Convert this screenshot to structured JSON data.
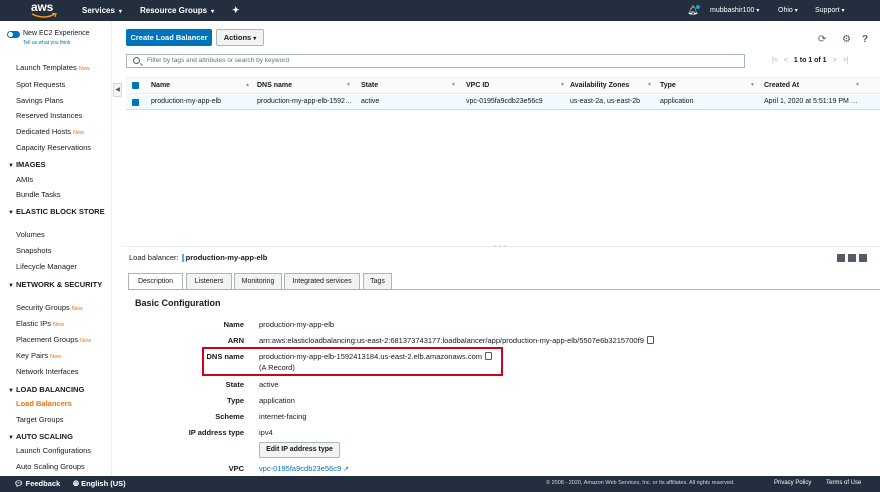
{
  "topnav": {
    "logo": "aws",
    "services": "Services",
    "resource_groups": "Resource Groups",
    "user": "mubbashir100",
    "region": "Ohio",
    "support": "Support"
  },
  "sidebar": {
    "experience_title": "New EC2 Experience",
    "experience_sub": "Tell us what you think",
    "new_tag": "New",
    "items": [
      {
        "label": "Launch Templates",
        "new": true
      },
      {
        "label": "Spot Requests",
        "new": false
      },
      {
        "label": "Savings Plans",
        "new": false
      },
      {
        "label": "Reserved Instances",
        "new": false
      },
      {
        "label": "Dedicated Hosts",
        "new": true
      },
      {
        "label": "Capacity Reservations",
        "new": false
      }
    ],
    "images_head": "IMAGES",
    "images_items": [
      "AMIs",
      "Bundle Tasks"
    ],
    "ebs_head": "ELASTIC BLOCK STORE",
    "ebs_items": [
      "Volumes",
      "Snapshots",
      "Lifecycle Manager"
    ],
    "net_head": "NETWORK & SECURITY",
    "net_items": [
      {
        "label": "Security Groups",
        "new": true
      },
      {
        "label": "Elastic IPs",
        "new": true
      },
      {
        "label": "Placement Groups",
        "new": true
      },
      {
        "label": "Key Pairs",
        "new": true
      },
      {
        "label": "Network Interfaces",
        "new": false
      }
    ],
    "lb_head": "LOAD BALANCING",
    "lb_items": [
      "Load Balancers",
      "Target Groups"
    ],
    "as_head": "AUTO SCALING",
    "as_items": [
      "Launch Configurations",
      "Auto Scaling Groups"
    ]
  },
  "toolbar": {
    "create_label": "Create Load Balancer",
    "actions_label": "Actions"
  },
  "search": {
    "placeholder": "Filter by tags and attributes or search by keyword"
  },
  "pager": {
    "text": "1 to 1 of 1"
  },
  "table": {
    "columns": [
      "Name",
      "DNS name",
      "State",
      "VPC ID",
      "Availability Zones",
      "Type",
      "Created At"
    ],
    "rows": [
      {
        "name": "production-my-app-elb",
        "dns": "production-my-app-elb-1592…",
        "state": "active",
        "vpc": "vpc-0195fa9cdb23e56c9",
        "az": "us-east-2a, us-east-2b",
        "type": "application",
        "created": "April 1, 2020 at 5:51:19 PM …"
      }
    ]
  },
  "detail": {
    "lb_label": "Load balancer:",
    "lb_name": "production-my-app-elb",
    "tabs": [
      "Description",
      "Listeners",
      "Monitoring",
      "Integrated services",
      "Tags"
    ],
    "section_title": "Basic Configuration",
    "fields": {
      "name_k": "Name",
      "name_v": "production-my-app-elb",
      "arn_k": "ARN",
      "arn_v": "arn:aws:elasticloadbalancing:us-east-2:681373743177:loadbalancer/app/production-my-app-elb/5507e6b3215700f9",
      "dns_k": "DNS name",
      "dns_v": "production-my-app-elb-1592413184.us-east-2.elb.amazonaws.com",
      "dns_sub": "(A Record)",
      "state_k": "State",
      "state_v": "active",
      "type_k": "Type",
      "type_v": "application",
      "scheme_k": "Scheme",
      "scheme_v": "internet-facing",
      "ip_k": "IP address type",
      "ip_v": "ipv4",
      "edit_ip_label": "Edit IP address type",
      "vpc_k": "VPC",
      "vpc_v": "vpc-0195fa9cdb23e56c9"
    }
  },
  "footer": {
    "feedback": "Feedback",
    "language": "English (US)",
    "copyright": "© 2008 - 2020, Amazon Web Services, Inc. or its affiliates. All rights reserved.",
    "privacy": "Privacy Policy",
    "terms": "Terms of Use"
  },
  "colors": {
    "nav_bg": "#232f3e",
    "primary": "#0073bb",
    "accent": "#ec7211",
    "highlight": "#d0021b"
  }
}
